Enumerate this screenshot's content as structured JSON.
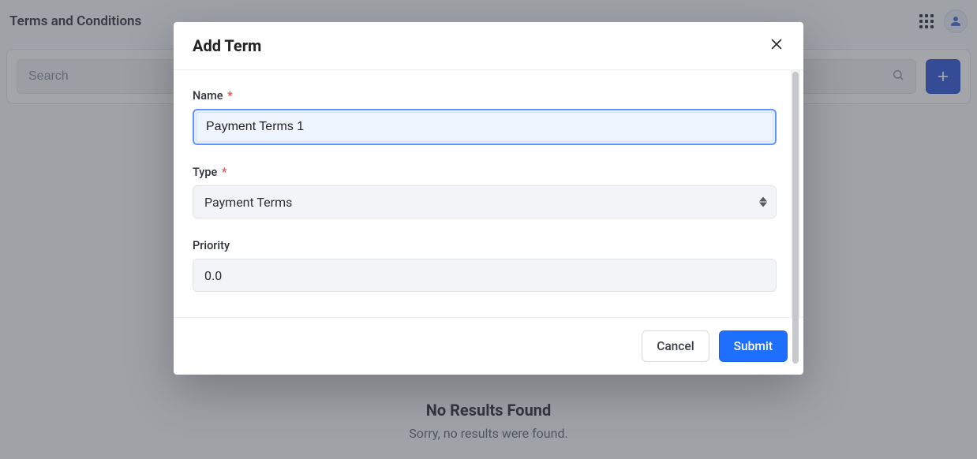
{
  "page": {
    "title": "Terms and Conditions",
    "search_placeholder": "Search"
  },
  "empty": {
    "title": "No Results Found",
    "subtitle": "Sorry, no results were found."
  },
  "modal": {
    "title": "Add Term",
    "fields": {
      "name": {
        "label": "Name",
        "required": true,
        "value": "Payment Terms 1"
      },
      "type": {
        "label": "Type",
        "required": true,
        "value": "Payment Terms"
      },
      "priority": {
        "label": "Priority",
        "required": false,
        "value": "0.0"
      }
    },
    "buttons": {
      "cancel": "Cancel",
      "submit": "Submit"
    },
    "required_mark": "*"
  }
}
